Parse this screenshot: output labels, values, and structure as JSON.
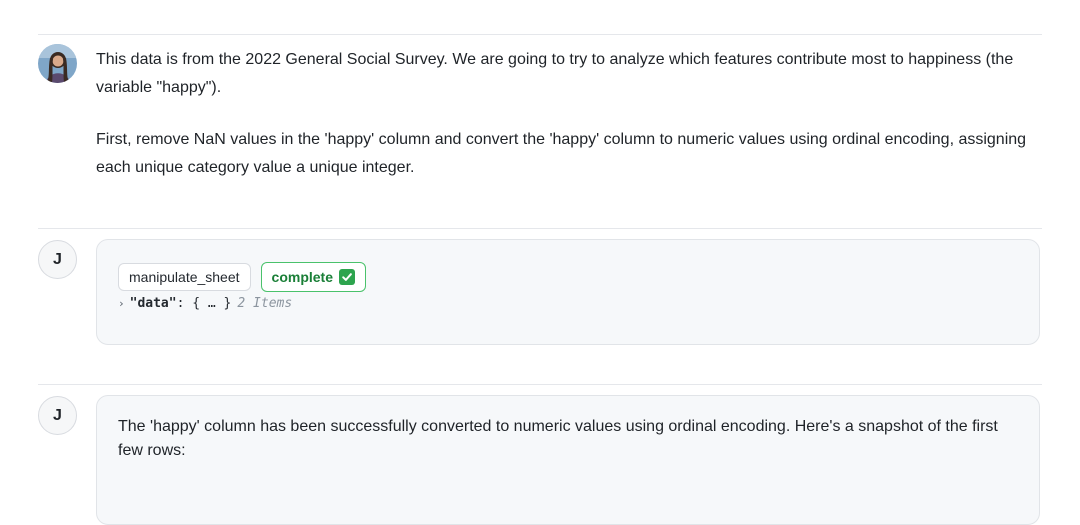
{
  "messages": [
    {
      "role": "user",
      "avatar_icon": "user-photo-avatar",
      "paragraphs": [
        "This data is from the 2022 General Social Survey. We are going to try to analyze which features contribute most to happiness (the variable \"happy\").",
        "First, remove NaN values in the 'happy' column and convert the 'happy' column to numeric values using ordinal encoding, assigning each unique category value a unique integer."
      ]
    },
    {
      "role": "assistant",
      "avatar_initial": "J",
      "tool_call": {
        "name": "manipulate_sheet",
        "status": "complete",
        "status_icon": "check-box-icon",
        "status_color": "#1a7f37",
        "result_key": "\"data\"",
        "result_preview": "{ … }",
        "result_count": "2 Items"
      }
    },
    {
      "role": "assistant",
      "avatar_initial": "J",
      "text": "The 'happy' column has been successfully converted to numeric values using ordinal encoding. Here's a snapshot of the first few rows:"
    }
  ]
}
